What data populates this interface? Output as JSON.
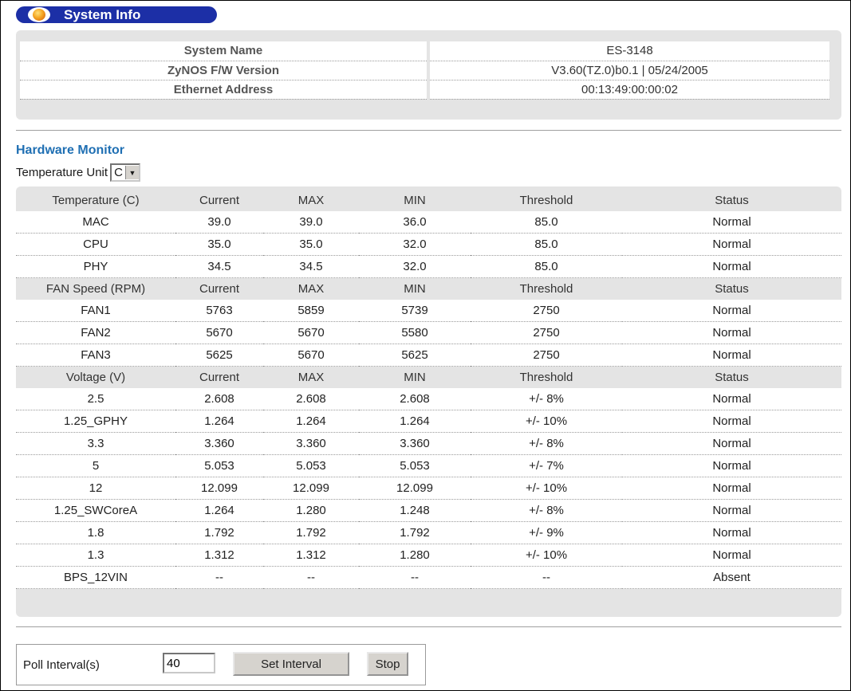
{
  "system_info": {
    "title": "System Info",
    "rows": [
      {
        "label": "System Name",
        "value": "ES-3148"
      },
      {
        "label": "ZyNOS F/W Version",
        "value": "V3.60(TZ.0)b0.1 | 05/24/2005"
      },
      {
        "label": "Ethernet Address",
        "value": "00:13:49:00:00:02"
      }
    ]
  },
  "hardware_monitor": {
    "title": "Hardware Monitor",
    "temperature_unit_label": "Temperature Unit",
    "temperature_unit_value": "C",
    "temperature": {
      "headers": [
        "Temperature (C)",
        "Current",
        "MAX",
        "MIN",
        "Threshold",
        "Status"
      ],
      "rows": [
        [
          "MAC",
          "39.0",
          "39.0",
          "36.0",
          "85.0",
          "Normal"
        ],
        [
          "CPU",
          "35.0",
          "35.0",
          "32.0",
          "85.0",
          "Normal"
        ],
        [
          "PHY",
          "34.5",
          "34.5",
          "32.0",
          "85.0",
          "Normal"
        ]
      ]
    },
    "fan": {
      "headers": [
        "FAN Speed (RPM)",
        "Current",
        "MAX",
        "MIN",
        "Threshold",
        "Status"
      ],
      "rows": [
        [
          "FAN1",
          "5763",
          "5859",
          "5739",
          "2750",
          "Normal"
        ],
        [
          "FAN2",
          "5670",
          "5670",
          "5580",
          "2750",
          "Normal"
        ],
        [
          "FAN3",
          "5625",
          "5670",
          "5625",
          "2750",
          "Normal"
        ]
      ]
    },
    "voltage": {
      "headers": [
        "Voltage (V)",
        "Current",
        "MAX",
        "MIN",
        "Threshold",
        "Status"
      ],
      "rows": [
        [
          "2.5",
          "2.608",
          "2.608",
          "2.608",
          "+/- 8%",
          "Normal"
        ],
        [
          "1.25_GPHY",
          "1.264",
          "1.264",
          "1.264",
          "+/- 10%",
          "Normal"
        ],
        [
          "3.3",
          "3.360",
          "3.360",
          "3.360",
          "+/- 8%",
          "Normal"
        ],
        [
          "5",
          "5.053",
          "5.053",
          "5.053",
          "+/- 7%",
          "Normal"
        ],
        [
          "12",
          "12.099",
          "12.099",
          "12.099",
          "+/- 10%",
          "Normal"
        ],
        [
          "1.25_SWCoreA",
          "1.264",
          "1.280",
          "1.248",
          "+/- 8%",
          "Normal"
        ],
        [
          "1.8",
          "1.792",
          "1.792",
          "1.792",
          "+/- 9%",
          "Normal"
        ],
        [
          "1.3",
          "1.312",
          "1.312",
          "1.280",
          "+/- 10%",
          "Normal"
        ],
        [
          "BPS_12VIN",
          "--",
          "--",
          "--",
          "--",
          "Absent"
        ]
      ]
    }
  },
  "poll": {
    "label": "Poll Interval(s)",
    "value": "40",
    "set_interval_label": "Set Interval",
    "stop_label": "Stop"
  }
}
